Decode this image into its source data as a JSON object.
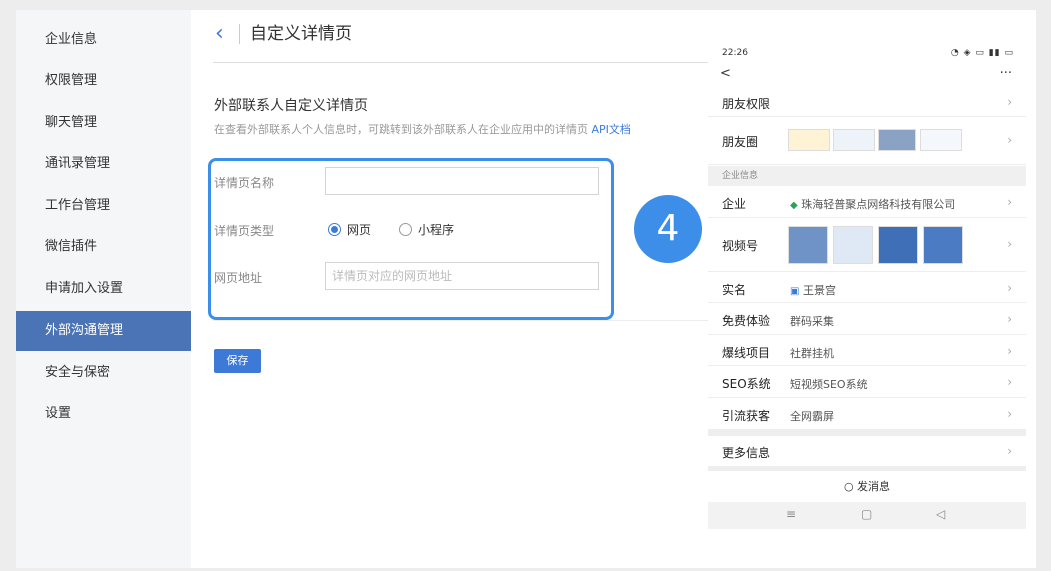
{
  "sidebar": {
    "items": [
      {
        "label": "企业信息"
      },
      {
        "label": "权限管理"
      },
      {
        "label": "聊天管理"
      },
      {
        "label": "通讯录管理"
      },
      {
        "label": "工作台管理"
      },
      {
        "label": "微信插件"
      },
      {
        "label": "申请加入设置"
      },
      {
        "label": "外部沟通管理",
        "active": true
      },
      {
        "label": "安全与保密"
      },
      {
        "label": "设置"
      }
    ]
  },
  "header": {
    "title": "自定义详情页"
  },
  "section": {
    "title": "外部联系人自定义详情页",
    "desc_prefix": "在查看外部联系人个人信息时，可跳转到该外部联系人在企业应用中的详情页",
    "desc_link": "API文档"
  },
  "form": {
    "name_label": "详情页名称",
    "name_value": "",
    "type_label": "详情页类型",
    "type_options": [
      {
        "label": "网页",
        "checked": true
      },
      {
        "label": "小程序",
        "checked": false
      }
    ],
    "url_label": "网页地址",
    "url_placeholder": "详情页对应的网页地址"
  },
  "save_label": "保存",
  "step_badge": "4",
  "phone": {
    "status_time": "22:26",
    "back": "<",
    "more": "···",
    "rows": [
      {
        "label": "朋友权限",
        "value": ""
      },
      {
        "label": "朋友圈",
        "value": ""
      },
      {
        "label": "企业",
        "value": "珠海轻普聚点网络科技有限公司"
      },
      {
        "label": "视频号",
        "value": ""
      },
      {
        "label": "实名",
        "value": "王景宫"
      },
      {
        "label": "免费体验",
        "value": "群码采集"
      },
      {
        "label": "爆线项目",
        "value": "社群挂机"
      },
      {
        "label": "SEO系统",
        "value": "短视频SEO系统"
      },
      {
        "label": "引流获客",
        "value": "全网霸屏"
      },
      {
        "label": "更多信息",
        "value": ""
      }
    ],
    "section_header": "企业信息",
    "send_message": "发消息"
  },
  "colors": {
    "accent": "#3d7ad7",
    "sidebar_active": "#4a74b5",
    "highlight_border": "#3d8ee8"
  }
}
